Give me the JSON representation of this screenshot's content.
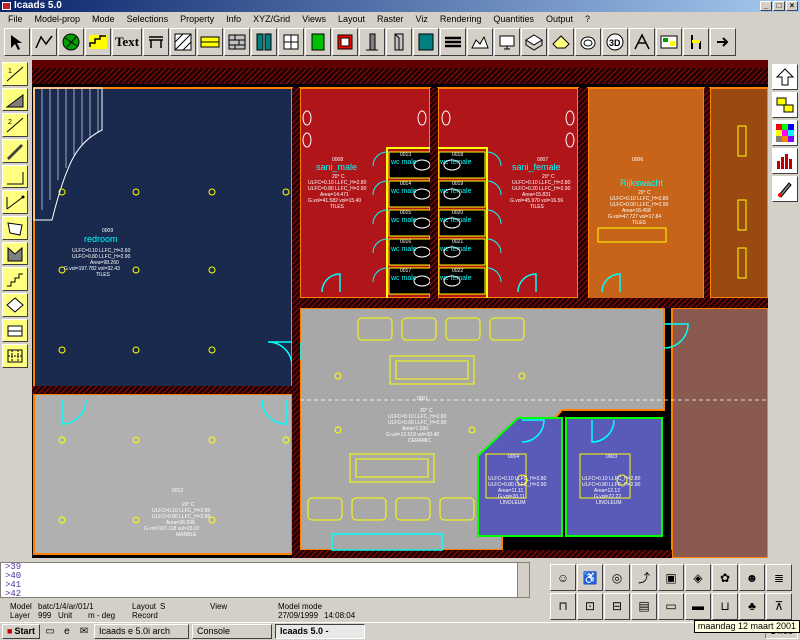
{
  "window": {
    "title": "Icaads 5.0"
  },
  "window_buttons": [
    "_",
    "□",
    "×"
  ],
  "menu": [
    "File",
    "Model-prop",
    "Mode",
    "Selections",
    "Property",
    "Info",
    "XYZ/Grid",
    "Views",
    "Layout",
    "Raster",
    "Viz",
    "Rendering",
    "Quantities",
    "Output",
    "?"
  ],
  "toolbar": {
    "text_label": "Text",
    "icons": [
      "select-icon",
      "polyline-icon",
      "circle-globe-icon",
      "stair-icon",
      "text-icon",
      "table-icon",
      "hatch-icon",
      "wall-icon",
      "brick-wall-icon",
      "door-icon",
      "window-icon",
      "green-door-icon",
      "panel-icon",
      "column-icon",
      "elevation-icon",
      "sectionview-icon",
      "stack-icon",
      "terrain-icon",
      "monitor-icon",
      "grid-3d-icon",
      "roof-icon",
      "toilet-icon",
      "view-3d-icon",
      "frame-icon",
      "furniture-icon",
      "chair-icon",
      "arrow-icon"
    ]
  },
  "left_tools": [
    "draw-line-icon",
    "draw-slope-icon",
    "draw-diag-icon",
    "draw-pen-icon",
    "draw-angle-icon",
    "draw-corner-icon",
    "draw-rect-icon",
    "draw-poly-icon",
    "draw-stair-icon",
    "draw-diamond-icon",
    "draw-box-icon",
    "draw-hatch-icon"
  ],
  "right_tools": [
    "up-arrow-icon",
    "layers-icon",
    "palette-icon",
    "chart-icon",
    "paint-icon"
  ],
  "rooms": {
    "redroom": {
      "number": "0009",
      "name": "redroom",
      "lines": [
        "ULFC=0.10  LLFC_H=2.60",
        "ULFC=0.80  LLFC_H=2.90",
        "Area=98.260",
        "G.vol=197.782 vol=32.43",
        "TILES"
      ]
    },
    "sani_male": {
      "number": "0008",
      "name": "sani_male",
      "lines": [
        "20° C",
        "ULFC=0.10  LLFC_H=2.80",
        "ULFC=0.80  LLFC_H=2.90",
        "Area=14.471",
        "G.vol=41.582 vol=15.40",
        "TILES"
      ]
    },
    "sani_female": {
      "number": "0007",
      "name": "sani_female",
      "lines": [
        "20° C",
        "ULFC=0.10  LLFC_H=2.80",
        "ULFC=0.20  LLFC_H=2.90",
        "Area=15.831",
        "G.vol=45.970 vol=16.56",
        "TILES"
      ]
    },
    "rijkswacht": {
      "number": "0006",
      "name": "Rijkswacht",
      "lines": [
        "20° C",
        "ULFC=0.10  LLFC_H=2.80",
        "ULFC=0.00  LLFC_H=2.90",
        "Area=16.458",
        "G.vol=47.727 vol=17.84",
        "TILES"
      ]
    },
    "central": {
      "number": "0001",
      "lines": [
        "20° C",
        "ULFC=0.10  LLFC_H=2.60",
        "ULFC=0.00  LLFC_H=2.90",
        "Area=1.030",
        "G.vol=12.519 vol=30.40",
        "CERAMIC"
      ]
    },
    "grey_room": {
      "number": "0012",
      "lines": [
        "20° C",
        "ULFC=0.10  LLFC_H=2.80",
        "ULFC=0.80  LLFC_H=2.90",
        "Area=36.936",
        "G.vol=107.118 vol=23.07",
        "MARBLE"
      ]
    },
    "cell1": {
      "number": "0004",
      "lines": [
        "ULFC=0.10  LLFC_H=2.80",
        "ULFC=0.80  LLFC_H=2.90",
        "Area=11.11",
        "G.vol=20.11",
        "LINOLEUM"
      ]
    },
    "cell2": {
      "number": "0003",
      "lines": [
        "ULFC=0.10  LLFC_H=2.80",
        "ULFC=0.80  LLFC_H=2.90",
        "Area=12.12",
        "G.vol=22.22",
        "LINOLEUM"
      ]
    }
  },
  "wc_stalls": {
    "left": [
      {
        "num": "0013",
        "label": "wc male"
      },
      {
        "num": "0014",
        "label": "wc male"
      },
      {
        "num": "0015",
        "label": "wc male"
      },
      {
        "num": "0016",
        "label": "wc male"
      },
      {
        "num": "0017",
        "label": "wc male"
      }
    ],
    "right": [
      {
        "num": "0018",
        "label": "wc female"
      },
      {
        "num": "0019",
        "label": "wc female"
      },
      {
        "num": "0020",
        "label": "wc female"
      },
      {
        "num": "0021",
        "label": "wc female"
      },
      {
        "num": "0022",
        "label": "wc female"
      }
    ]
  },
  "colors": {
    "redroom": "#1a2a4f",
    "sani": "#b0151a",
    "rijkswacht": "#c8641a",
    "right_room": "#9a4a10",
    "central": "#a8a8a8",
    "cell": "#5a5ab8",
    "wall": "#ff8000",
    "yellow": "#ffff00",
    "cyan": "#00ffff",
    "green": "#00ff00"
  },
  "command_lines": [
    ">39",
    ">40",
    ">41",
    ">42"
  ],
  "status": {
    "model_label": "Model",
    "model_value": "batc/1/4/ar/01/1",
    "layer_label": "Layer",
    "layer_value": "999",
    "unit_label": "Unit",
    "unit_value": "m - deg",
    "layout_label": "Layout",
    "layout_value": "S",
    "record_label": "Record",
    "view_label": "View",
    "mode_label": "Model mode",
    "date_value": "27/09/1999",
    "time_value": "14:08:04"
  },
  "bottom_right_tools": [
    "figure-icon",
    "wheelchair-icon",
    "globe-icon",
    "route-icon",
    "screen-icon",
    "camera-icon",
    "plant-icon",
    "people-icon",
    "bench-icon",
    "stack-icon",
    "cart-icon",
    "truck-icon",
    "bus-icon",
    "car-icon",
    "car2-icon",
    "sofa-icon",
    "tree-icon",
    "crane-icon"
  ],
  "taskbar": {
    "start": "Start",
    "items": [
      "Icaads e 5.0i arch",
      "Console",
      "Icaads 5.0 -"
    ],
    "clock": "14:08",
    "tooltip": "maandag 12 maart 2001"
  }
}
